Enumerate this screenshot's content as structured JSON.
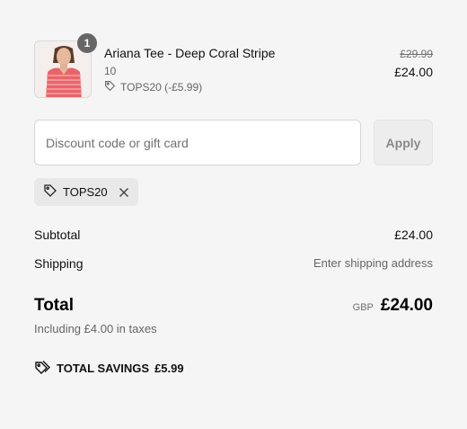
{
  "cart": {
    "quantity": "1",
    "item": {
      "name": "Ariana Tee - Deep Coral Stripe",
      "variant": "10",
      "discount_label": "TOPS20 (-£5.99)",
      "compare_price": "£29.99",
      "price": "£24.00"
    }
  },
  "discount": {
    "placeholder": "Discount code or gift card",
    "value": "",
    "apply_label": "Apply",
    "applied_code": "TOPS20"
  },
  "summary": {
    "subtotal_label": "Subtotal",
    "subtotal_value": "£24.00",
    "shipping_label": "Shipping",
    "shipping_value": "Enter shipping address",
    "total_label": "Total",
    "currency": "GBP",
    "total_value": "£24.00",
    "taxes_note": "Including £4.00 in taxes",
    "savings_label": "TOTAL SAVINGS",
    "savings_value": "£5.99"
  },
  "colors": {
    "background": "#f5f5f5",
    "badge": "#666666",
    "chip": "#e8e8e8",
    "muted_text": "#666666"
  },
  "icons": [
    "tag-icon",
    "close-icon",
    "tags-icon"
  ]
}
